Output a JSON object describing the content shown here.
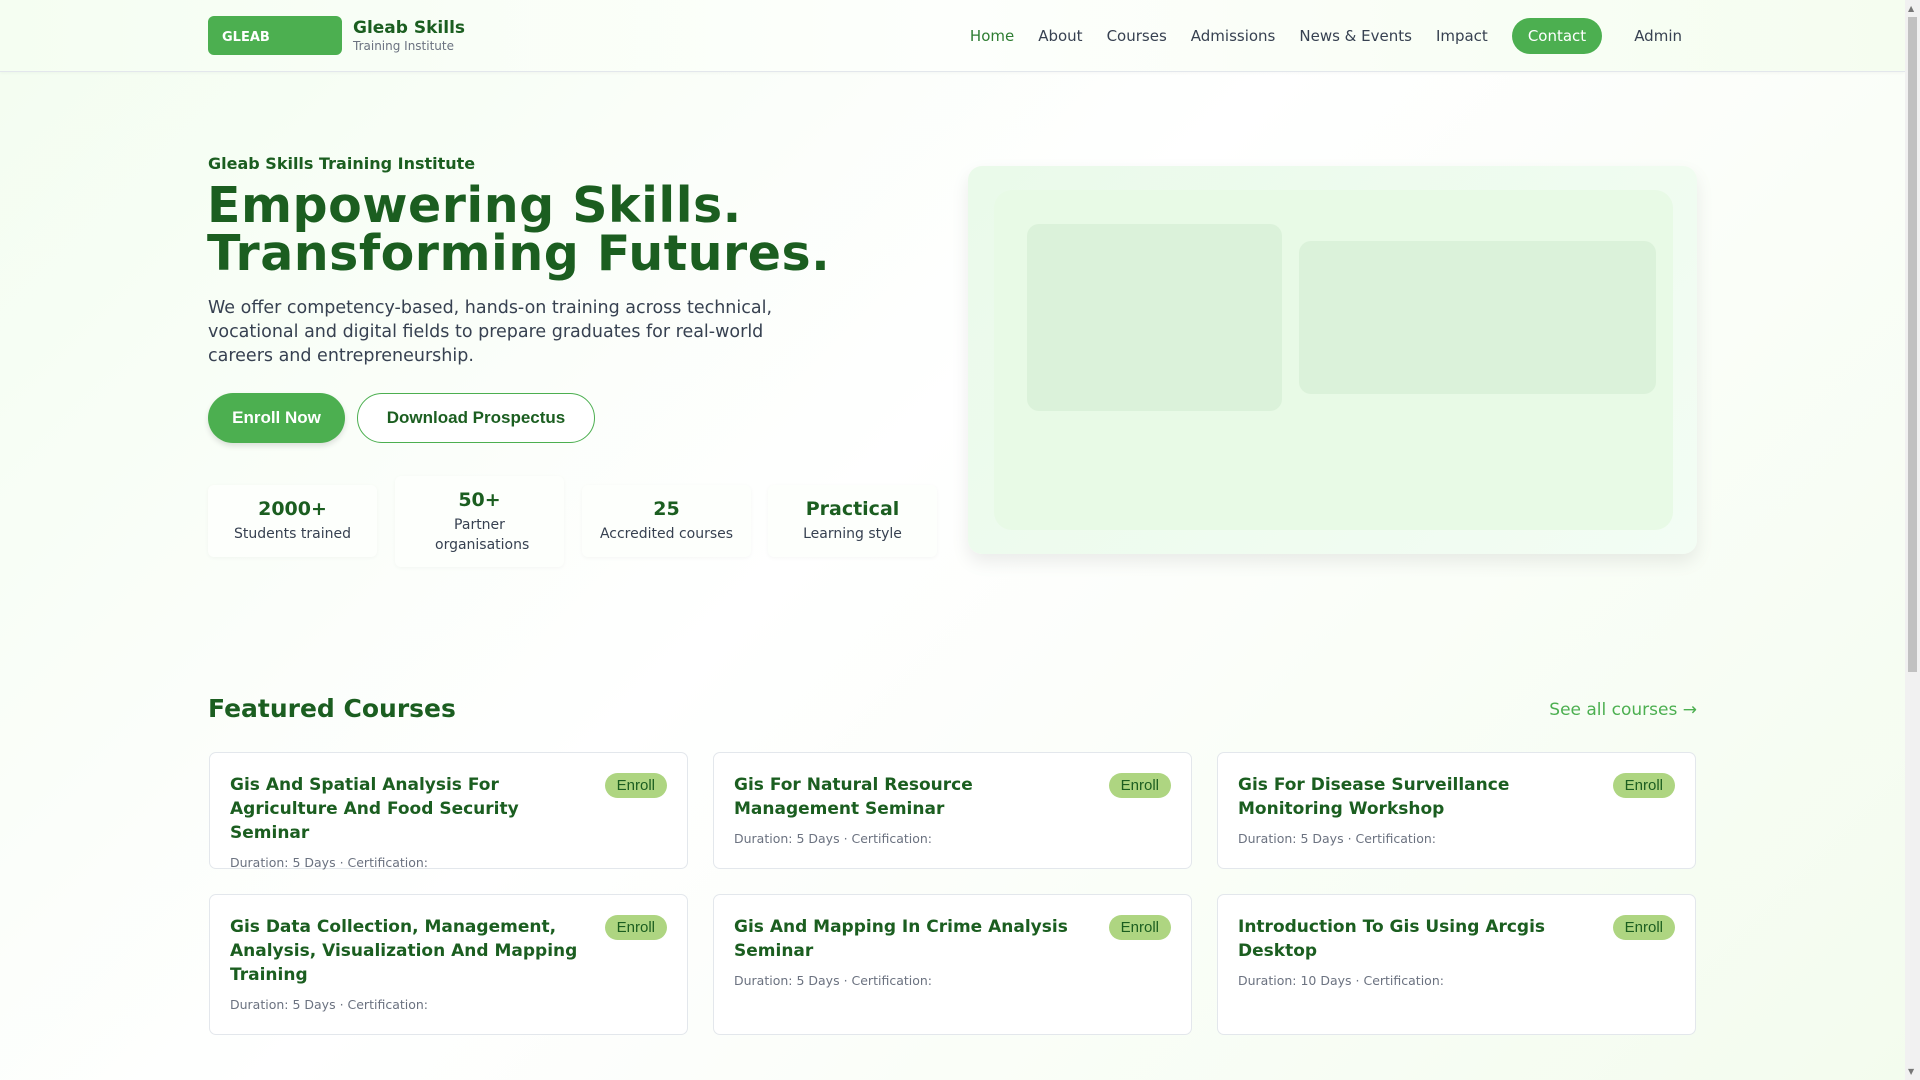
{
  "header": {
    "logo_text": "GLEAB",
    "brand_name": "Gleab Skills",
    "brand_sub": "Training Institute",
    "nav": [
      "Home",
      "About",
      "Courses",
      "Admissions",
      "News & Events",
      "Impact"
    ],
    "contact": "Contact",
    "admin": "Admin"
  },
  "hero": {
    "eyebrow": "Gleab Skills Training Institute",
    "title_line1": "Empowering Skills.",
    "title_line2": "Transforming Futures.",
    "lead": "We offer competency-based, hands-on training across technical, vocational and digital fields to prepare graduates for real-world careers and entrepreneurship.",
    "enroll": "Enroll Now",
    "prospectus": "Download Prospectus",
    "stats": [
      {
        "value": "2000+",
        "label": "Students trained"
      },
      {
        "value": "50+",
        "label": "Partner organisations"
      },
      {
        "value": "25",
        "label": "Accredited courses"
      },
      {
        "value": "Practical",
        "label": "Learning style"
      }
    ]
  },
  "featured": {
    "title": "Featured Courses",
    "see_all": "See all courses →",
    "enroll_label": "Enroll",
    "courses": [
      {
        "title": "Gis And Spatial Analysis For Agriculture And Food Security Seminar",
        "meta": "Duration: 5 Days · Certification:"
      },
      {
        "title": "Gis For Natural Resource Management Seminar",
        "meta": "Duration: 5 Days · Certification:"
      },
      {
        "title": "Gis For Disease Surveillance Monitoring Workshop",
        "meta": "Duration: 5 Days · Certification:"
      },
      {
        "title": "Gis Data Collection, Management, Analysis, Visualization And Mapping Training",
        "meta": "Duration: 5 Days · Certification:"
      },
      {
        "title": "Gis And Mapping In Crime Analysis Seminar",
        "meta": "Duration: 5 Days · Certification:"
      },
      {
        "title": "Introduction To Gis Using Arcgis Desktop",
        "meta": "Duration: 10 Days · Certification:"
      }
    ]
  },
  "colors": {
    "primary": "#4caf50",
    "dark": "#1b5e20",
    "badge": "#aed581"
  }
}
